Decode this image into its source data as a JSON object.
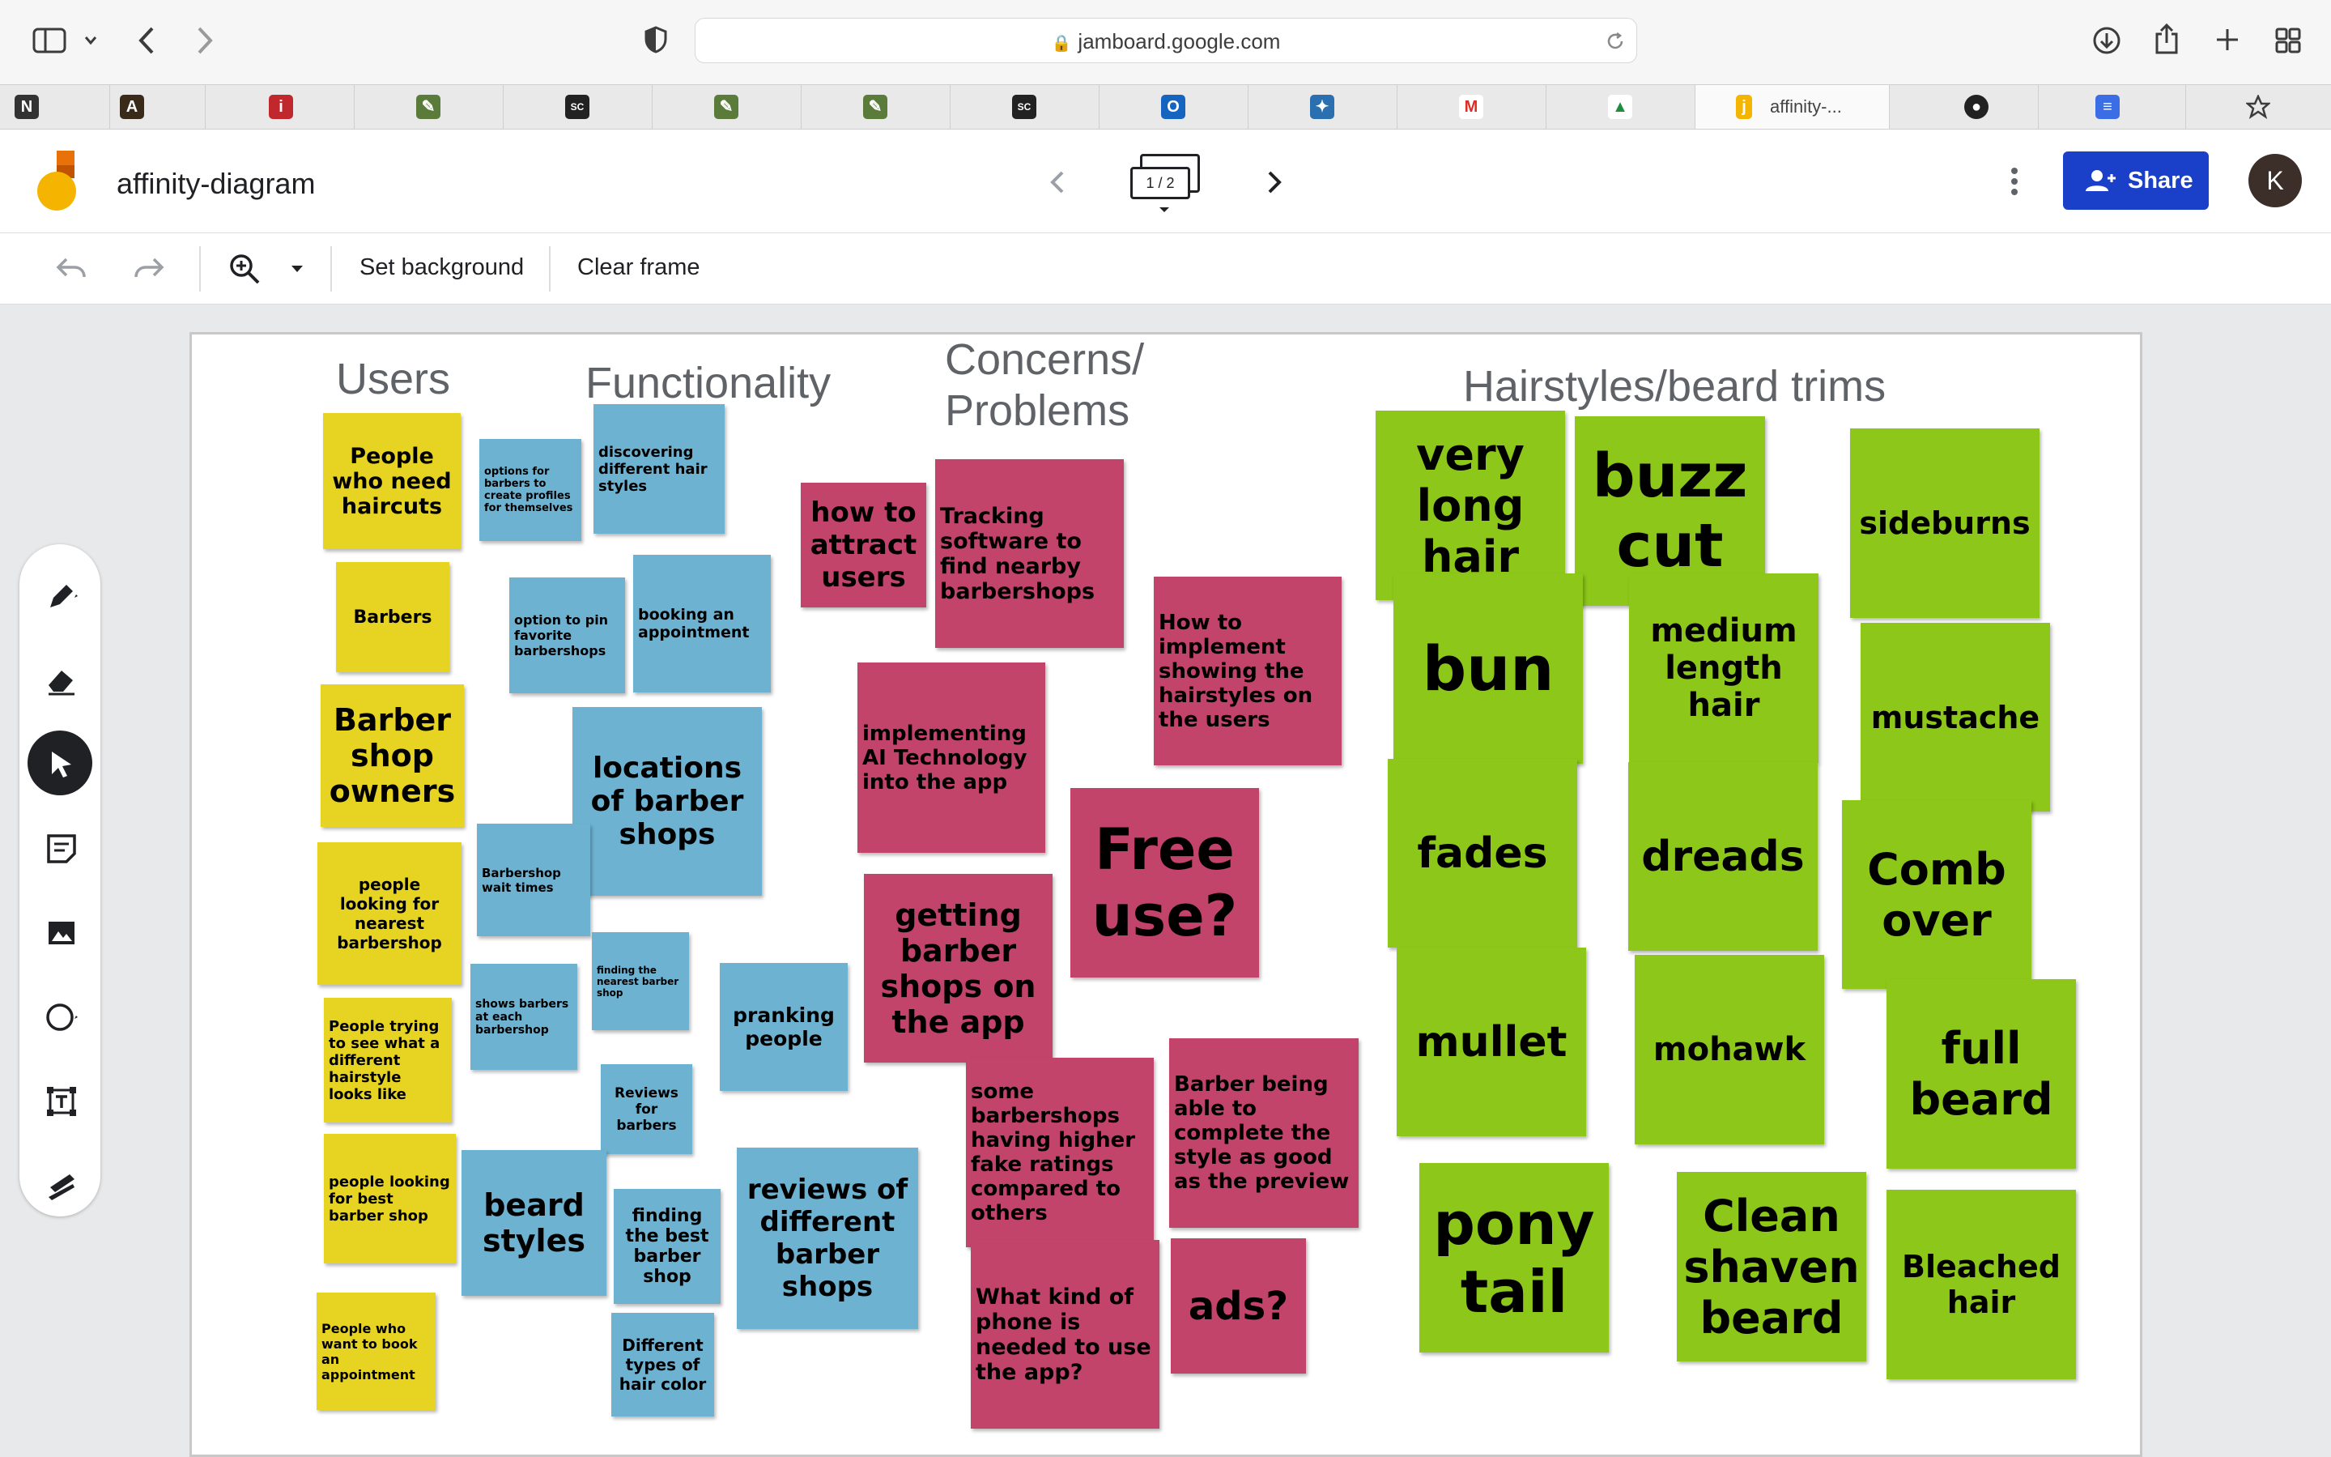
{
  "browser": {
    "url": "jamboard.google.com",
    "active_tab_label": "affinity-..."
  },
  "app": {
    "title": "affinity-diagram",
    "frame_counter": "1 / 2",
    "share_label": "Share",
    "avatar_initial": "K"
  },
  "toolbar": {
    "set_background": "Set background",
    "clear_frame": "Clear frame"
  },
  "colors": {
    "yellow": "#e6d322",
    "blue": "#6eb2d2",
    "red": "#c2446a",
    "green": "#8dc71a",
    "share": "#1a3fc9"
  },
  "headings": {
    "users": "Users",
    "functionality": "Functionality",
    "concerns_1": "Concerns/",
    "concerns_2": "Problems",
    "hairstyles": "Hairstyles/beard trims"
  },
  "notes": {
    "users": [
      "People who need haircuts",
      "Barbers",
      "Barber shop owners",
      "people looking for nearest barbershop",
      "People trying to see what a different hairstyle looks like",
      "people looking for best barber shop",
      "People who want to book an appointment"
    ],
    "functionality": [
      "options for barbers to create profiles for themselves",
      "discovering different hair styles",
      "option to pin favorite barbershops",
      "booking an appointment",
      "locations of barber shops",
      "Barbershop wait times",
      "finding the nearest barber shop",
      "shows barbers at each barbershop",
      "pranking people",
      "Reviews for barbers",
      "beard styles",
      "finding the best barber shop",
      "reviews of different barber shops",
      "Different types of hair color"
    ],
    "concerns": [
      "how to attract users",
      "Tracking software to find nearby barbershops",
      "How to implement showing the hairstyles on the users",
      "implementing AI Technology into the app",
      "Free use?",
      "getting barber shops on the app",
      "some barbershops having higher fake ratings compared to others",
      "Barber being able to complete the style as good as the preview",
      "What kind of phone is needed to use the app?",
      "ads?"
    ],
    "hairstyles": [
      "very long hair",
      "buzz cut",
      "sideburns",
      "bun",
      "medium length hair",
      "mustache",
      "fades",
      "dreads",
      "Comb over",
      "mullet",
      "mohawk",
      "full beard",
      "pony tail",
      "Clean shaven beard",
      "Bleached hair"
    ]
  }
}
